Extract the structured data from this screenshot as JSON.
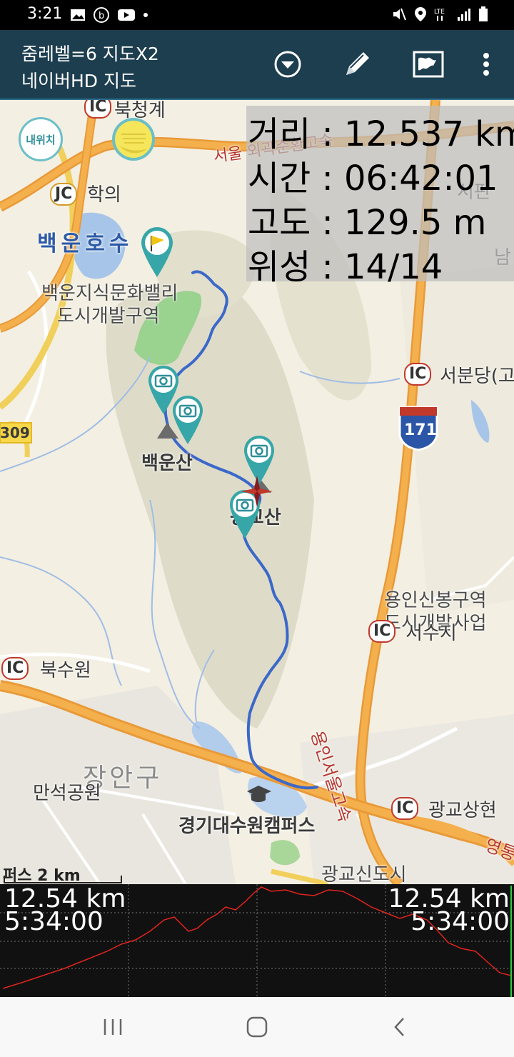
{
  "status": {
    "time": "3:21"
  },
  "appbar": {
    "line1": "줌레벨=6 지도X2",
    "line2": "네이버HD 지도"
  },
  "info": {
    "distance": "거리 : 12.537 km",
    "time": "시간 : 06:42:01",
    "altitude": "고도 : 129.5 m",
    "satellites": "위성 : 14/14"
  },
  "map": {
    "my_location": "내위치",
    "labels": {
      "bukcheonggye": "북청계",
      "seoul_ring": "서울 외곽순환고속",
      "haguui": "학의",
      "baegun_lake": "백운호수",
      "baegun_valley_1": "백운지식문화밸리",
      "baegun_valley_2": "도시개발구역",
      "baegunsan": "백운산",
      "gwanggyosan": "광교산",
      "seobundang": "서분당(고",
      "seopan": "서판",
      "nam": "남",
      "yongin_1": "용인신봉구역",
      "yongin_2": "도시개발사업",
      "seosuji": "서수지",
      "buksuwon": "북수원",
      "jangan": "장안구",
      "manseok": "만석공원",
      "kyonggi": "경기대수원캠퍼스",
      "gwanggyo_sanghyeon": "광교상현",
      "gwanggyo_new": "광교신도시",
      "yongin_seoul_hwy": "용인서울고속",
      "yeong": "영통",
      "road309": "309",
      "hwy171": "171"
    },
    "ic": "IC",
    "jc": "JC",
    "scale": "퍼스  2 km"
  },
  "elevation": {
    "left_distance": "12.54 km",
    "left_time": "5:34:00",
    "right_distance": "12.54 km",
    "right_time": "5:34:00"
  }
}
